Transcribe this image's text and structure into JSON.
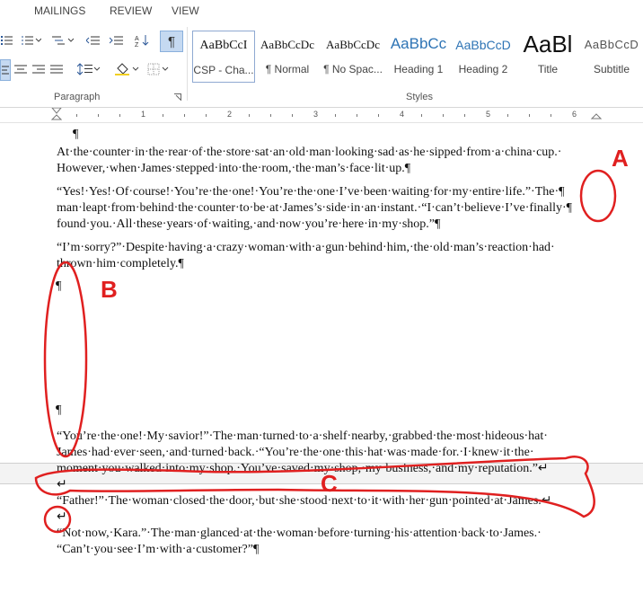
{
  "tabs": [
    "MAILINGS",
    "REVIEW",
    "VIEW"
  ],
  "ribbon": {
    "paragraph_label": "Paragraph",
    "styles_label": "Styles",
    "styles": [
      {
        "sample": "AaBbCcI",
        "name": "CSP - Cha..."
      },
      {
        "sample": "AaBbCcDc",
        "name": "¶ Normal"
      },
      {
        "sample": "AaBbCcDc",
        "name": "¶ No Spac..."
      },
      {
        "sample": "AaBbCc",
        "name": "Heading 1"
      },
      {
        "sample": "AaBbCcD",
        "name": "Heading 2"
      },
      {
        "sample": "AaBl",
        "name": "Title"
      },
      {
        "sample": "AaBbCcD",
        "name": "Subtitle"
      }
    ]
  },
  "ruler": {
    "numbers": [
      "1",
      "2",
      "3",
      "4",
      "5",
      "6"
    ]
  },
  "document": {
    "top_mark": "¶",
    "p1": [
      "At·the·counter·in·the·rear·of·the·store·sat·an·old·man·looking·sad·as·he·sipped·from·a·china·cup.·",
      "However,·when·James·stepped·into·the·room,·the·man’s·face·lit·up.¶"
    ],
    "p2": [
      "“Yes!·Yes!·Of·course!·You’re·the·one!·You’re·the·one·I’ve·been·waiting·for·my·entire·life.”·The·¶",
      "man·leapt·from·behind·the·counter·to·be·at·James’s·side·in·an·instant.·“I·can’t·believe·I’ve·finally·¶",
      "found·you.·All·these·years·of·waiting,·and·now·you’re·here·in·my·shop.”¶"
    ],
    "p3": [
      "“I’m·sorry?”·Despite·having·a·crazy·woman·with·a·gun·behind·him,·the·old·man’s·reaction·had·",
      "thrown·him·completely.¶"
    ],
    "empty_mark_1": "¶",
    "empty_mark_2": "¶",
    "p4": [
      "“You’re·the·one!·My·savior!”·The·man·turned·to·a·shelf·nearby,·grabbed·the·most·hideous·hat·",
      "James·had·ever·seen,·and·turned·back.·“You’re·the·one·this·hat·was·made·for.·I·knew·it·the·",
      "moment·you·walked·into·my·shop.·You’ve·saved·my·shop,·my·business,·and·my·reputation.”↵",
      "↵",
      "“Father!”·The·woman·closed·the·door,·but·she·stood·next·to·it·with·her·gun·pointed·at·James.↵",
      "↵",
      "“Not·now,·Kara.”·The·man·glanced·at·the·woman·before·turning·his·attention·back·to·James.·",
      "“Can’t·you·see·I’m·with·a·customer?”¶"
    ]
  },
  "annotations": {
    "a": "A",
    "b": "B",
    "c": "C"
  },
  "colors": {
    "annotation": "#e02020",
    "selected_button": "#c5d9f1"
  }
}
